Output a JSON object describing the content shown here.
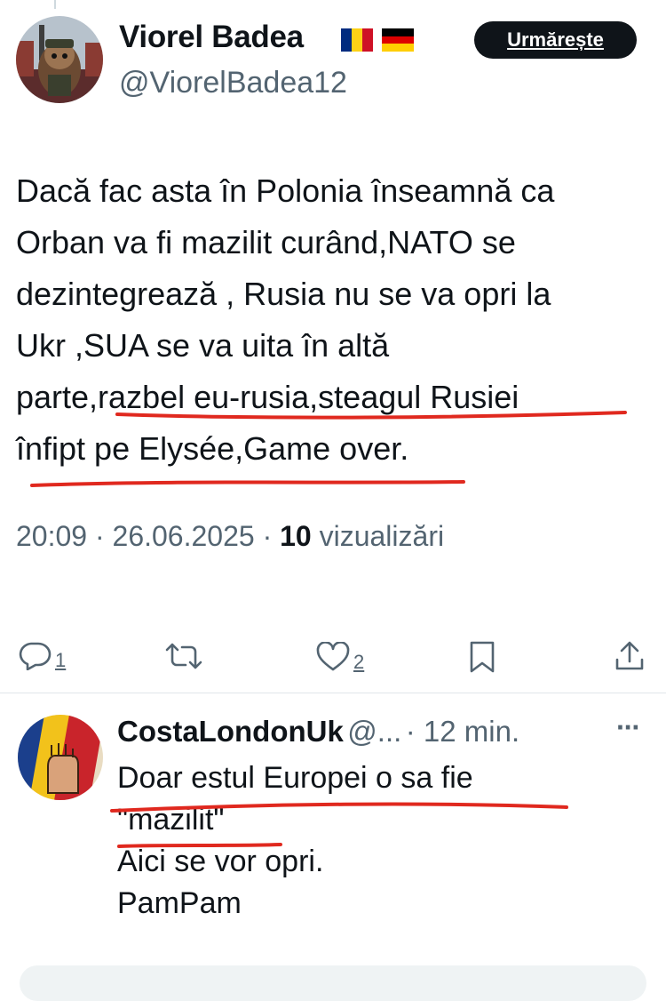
{
  "tweet": {
    "author_name": "Viorel Badea",
    "flags": [
      "Romania flag",
      "Germany flag"
    ],
    "handle": "@ViorelBadea12",
    "follow_label": "Urmărește",
    "text": "Dacă fac asta în Polonia înseamnă ca\nOrban va fi mazilit curând,NATO se\ndezintegrează , Rusia nu se va opri la\nUkr ,SUA se va uita în altă\nparte,razbel eu-rusia,steagul Rusiei\nînfipt pe Elysée,Game over.",
    "time": "20:09",
    "date": "26.06.2025",
    "views_count": "10",
    "views_label": "vizualizări",
    "actions": {
      "reply_count": "1",
      "like_count": "2"
    }
  },
  "reply": {
    "author_name": "CostaLondonUk",
    "handle": "@...",
    "time": "12 min.",
    "more_label": "···",
    "text": "Doar estul Europei o sa fie\n\"mazilit\"\nAici se vor opri.\nPamPam"
  },
  "colors": {
    "text": "#0f1419",
    "secondary": "#536471",
    "underline_annotation": "#e0291f",
    "divider": "#e1e6ea"
  }
}
